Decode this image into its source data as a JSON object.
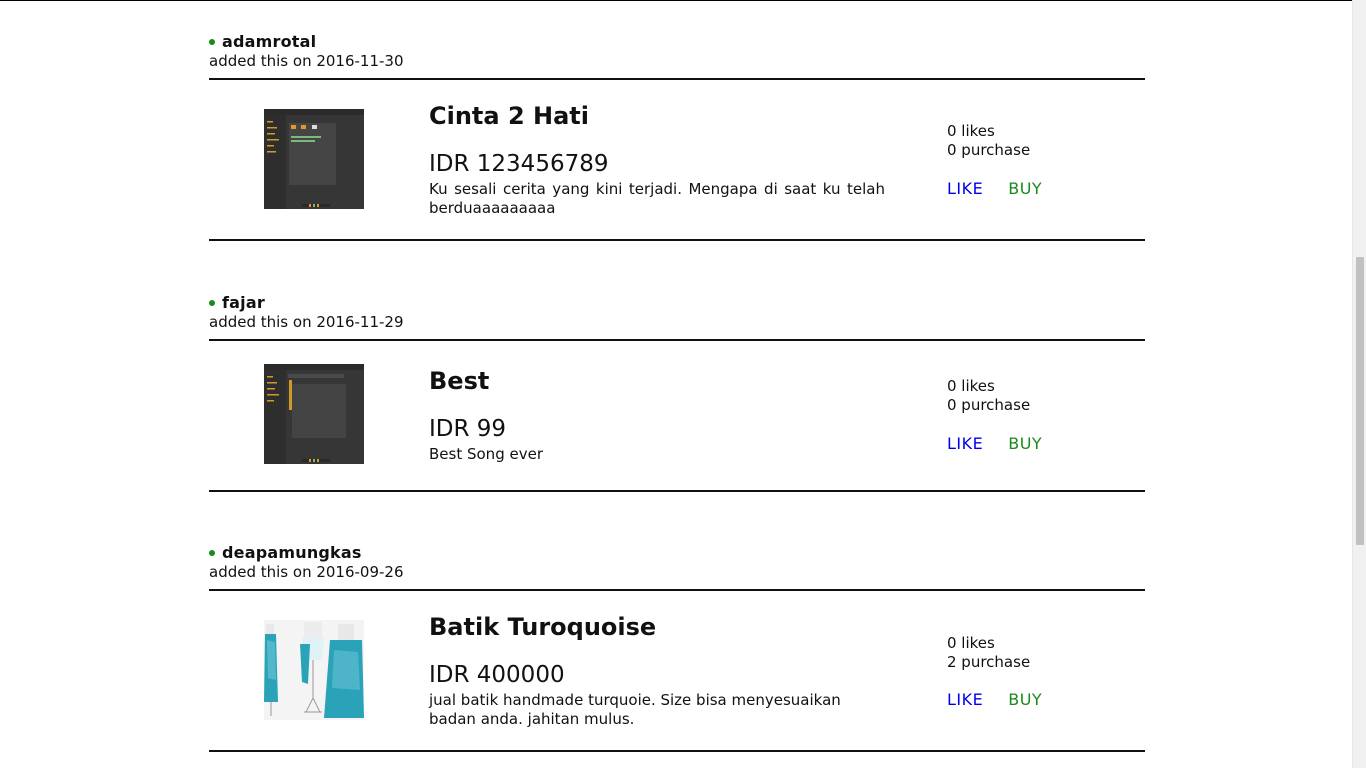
{
  "posts": [
    {
      "username": "adamrotal",
      "added": "added this on 2016-11-30",
      "title": "Cinta 2 Hati",
      "price": "IDR 123456789",
      "description": "Ku sesali cerita yang kini terjadi. Mengapa di saat ku telah berduaaaaaaaaa",
      "likes": "0 likes",
      "purchases": "0 purchase",
      "like_label": "LIKE",
      "buy_label": "BUY",
      "thumbnail": "screenshot-thumbnail"
    },
    {
      "username": "fajar",
      "added": "added this on 2016-11-29",
      "title": "Best",
      "price": "IDR 99",
      "description": "Best Song ever",
      "likes": "0 likes",
      "purchases": "0 purchase",
      "like_label": "LIKE",
      "buy_label": "BUY",
      "thumbnail": "screenshot-thumbnail"
    },
    {
      "username": "deapamungkas",
      "added": "added this on 2016-09-26",
      "title": "Batik Turoquoise",
      "price": "IDR 400000",
      "description": "jual batik handmade turquoie. Size bisa menyesuaikan badan anda. jahitan mulus.",
      "likes": "0 likes",
      "purchases": "2 purchase",
      "like_label": "LIKE",
      "buy_label": "BUY",
      "thumbnail": "batik-photo"
    }
  ],
  "colors": {
    "link_like": "#0000ee",
    "link_buy": "#1a8a1a",
    "status_dot": "#1a8a1a"
  }
}
